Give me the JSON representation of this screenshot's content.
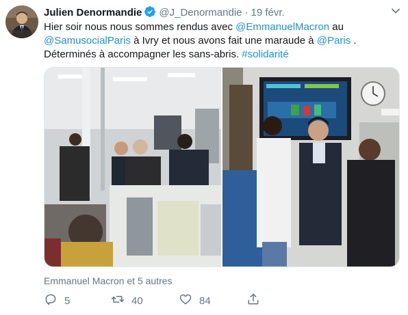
{
  "author": {
    "display_name": "Julien Denormandie",
    "handle": "@J_Denormandie",
    "separator": "·",
    "date": "19 févr.",
    "verified_icon": "verified-badge-icon",
    "avatar_icon": "avatar"
  },
  "tweet": {
    "text_parts": {
      "p1": "Hier soir nous nous sommes rendus avec ",
      "mention1": "@EmmanuelMacron",
      "p2": " au ",
      "mention2": "@SamusocialParis",
      "p3": " à Ivry et nous avons fait une maraude à ",
      "mention3": "@Paris",
      "p4": " . Déterminés à accompagner les sans-abris. ",
      "hashtag": "#solidarité"
    },
    "likers": "Emmanuel Macron et 5 autres"
  },
  "actions": {
    "reply_count": "5",
    "retweet_count": "40",
    "like_count": "84"
  },
  "colors": {
    "link": "#1b95e0",
    "meta": "#657786",
    "text": "#14171a",
    "verified": "#1da1f2"
  },
  "icons": [
    "caret-down-icon",
    "reply-icon",
    "retweet-icon",
    "like-icon",
    "share-icon"
  ]
}
